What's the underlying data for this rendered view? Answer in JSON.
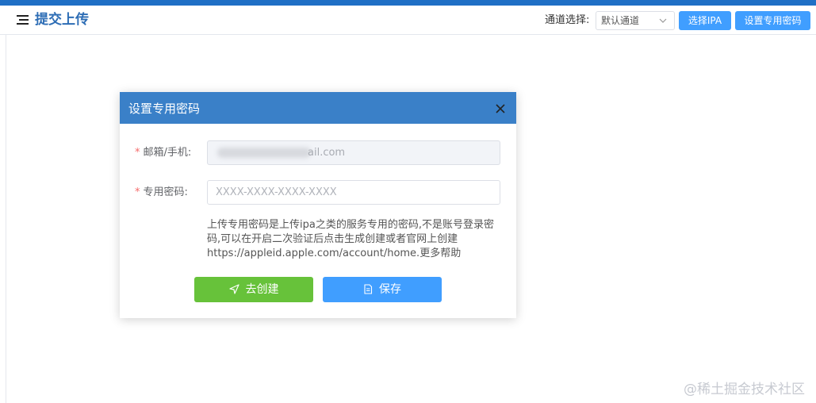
{
  "header": {
    "title": "提交上传",
    "channel_label": "通道选择:",
    "channel_selected": "默认通道",
    "select_ipa_label": "选择IPA",
    "set_password_label": "设置专用密码"
  },
  "dialog": {
    "title": "设置专用密码",
    "email_label": "邮箱/手机:",
    "email_value_visible": "ail.com",
    "password_label": "专用密码:",
    "password_placeholder": "XXXX-XXXX-XXXX-XXXX",
    "help_text": "上传专用密码是上传ipa之类的服务专用的密码,不是账号登录密码,可以在开启二次验证后点击生成创建或者官网上创建https://appleid.apple.com/account/home.更多帮助",
    "create_label": "去创建",
    "save_label": "保存",
    "required_mark": "*"
  },
  "watermark": "@稀土掘金技术社区",
  "colors": {
    "primary": "#409eff",
    "dialog_header": "#3a80c8",
    "success": "#67c23a",
    "title_blue": "#2d6db5",
    "required": "#f56c6c"
  }
}
